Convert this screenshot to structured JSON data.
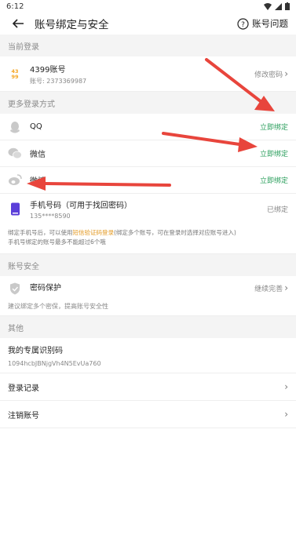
{
  "status_bar": {
    "time": "6:12"
  },
  "header": {
    "title": "账号绑定与安全",
    "help_label": "账号问题"
  },
  "sections": {
    "current_login": "当前登录",
    "more_login": "更多登录方式",
    "account_security": "账号安全",
    "other": "其他"
  },
  "current_account": {
    "name": "4399账号",
    "account": "账号: 2373369987",
    "action": "修改密码"
  },
  "login_methods": [
    {
      "label": "QQ",
      "action": "立即绑定"
    },
    {
      "label": "微信",
      "action": "立即绑定"
    },
    {
      "label": "微博",
      "action": "立即绑定"
    }
  ],
  "phone": {
    "label": "手机号码（可用于找回密码）",
    "number": "135****8590",
    "status": "已绑定"
  },
  "note": {
    "part1": "绑定手机号后，可以使用",
    "link": "短信验证码登录",
    "part2": "(绑定多个账号，可在登录时选择对应账号进入)",
    "line2": "手机号绑定的账号最多不能超过6个哦"
  },
  "security": {
    "label": "密码保护",
    "action": "继续完善",
    "hint": "建议绑定多个密保，提高账号安全性"
  },
  "other": {
    "id_label": "我的专属识别码",
    "id_value": "1094hcbJBNjgVh4N5EvUa760",
    "login_record": "登录记录",
    "cancel_account": "注销账号"
  },
  "colors": {
    "bind_green": "#2ea05f",
    "arrow_red": "#e8453c",
    "logo_orange": "#f5a623",
    "phone_purple": "#5b3fd9"
  },
  "icons": [
    "back-arrow-icon",
    "help-circle-icon",
    "4399-logo-icon",
    "qq-icon",
    "wechat-icon",
    "weibo-icon",
    "phone-icon",
    "shield-icon",
    "chevron-right-icon"
  ]
}
